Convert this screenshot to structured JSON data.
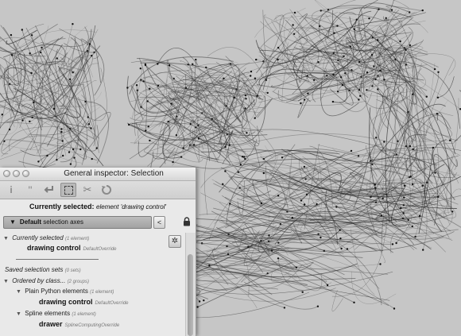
{
  "window": {
    "title": "General inspector: Selection"
  },
  "toolbar": {
    "tools": [
      {
        "icon": "info-icon",
        "active": false
      },
      {
        "icon": "quote-icon",
        "active": false
      },
      {
        "icon": "return-arrow-icon",
        "active": false
      },
      {
        "icon": "selection-rectangle-icon",
        "active": true
      },
      {
        "icon": "scissors-icon",
        "active": false
      },
      {
        "icon": "rotate-icon",
        "active": false
      }
    ]
  },
  "current_selection": {
    "label": "Currently selected:",
    "value": "element 'drawing control'"
  },
  "axes": {
    "name": "Default",
    "suffix": "selection axes",
    "prev_label": "<"
  },
  "tree": {
    "currently_selected": {
      "label": "Currently selected",
      "count": "(1 element)"
    },
    "drawing_control": {
      "name": "drawing control",
      "type": "DefaultOverride"
    },
    "saved_sets": {
      "label": "Saved selection sets",
      "count": "(0 sets)"
    },
    "ordered_by_class": {
      "label": "Ordered by class...",
      "count": "(2 groups)"
    },
    "plain_python": {
      "label": "Plain Python elements",
      "count": "(1 element)"
    },
    "drawing_control_2": {
      "name": "drawing control",
      "type": "DefaultOverride"
    },
    "spline_elements": {
      "label": "Spline elements",
      "count": "(1 element)"
    },
    "drawer": {
      "name": "drawer",
      "type": "SplineComputingOverride"
    }
  }
}
